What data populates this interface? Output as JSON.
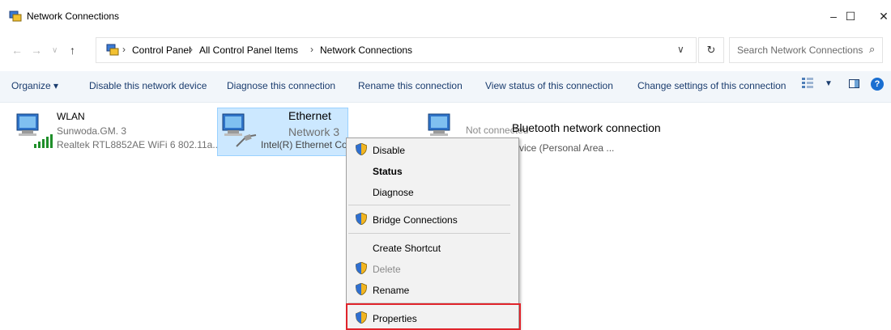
{
  "window": {
    "title": "Network Connections",
    "minimize": "–",
    "maximize": "☐",
    "close": "✕"
  },
  "address": {
    "back": "←",
    "forward": "→",
    "recent": "∨",
    "up": "↑",
    "sep": "›",
    "crumbs": [
      "Control Panel",
      "All Control Panel Items",
      "Network Connections"
    ],
    "dropdown": "∨",
    "refresh": "↻",
    "search_placeholder": "Search Network Connections",
    "search_icon": "⌕"
  },
  "toolbar": {
    "organize": "Organize ▾",
    "disable": "Disable this network device",
    "diagnose": "Diagnose this connection",
    "rename": "Rename this connection",
    "view_status": "View status of this connection",
    "change_settings": "Change settings of this connection",
    "view_dropdown": "▼",
    "help": "?"
  },
  "connections": [
    {
      "name": "WLAN",
      "network": "Sunwoda.GM. 3",
      "adapter": "Realtek RTL8852AE WiFi 6 802.11a..."
    },
    {
      "name": "Ethernet",
      "network": "Network 3",
      "adapter": "Intel(R) Ethernet Co"
    },
    {
      "name": "Bluetooth network connection",
      "network": "Not connected",
      "adapter": "vice (Personal Area ..."
    }
  ],
  "context_menu": {
    "items": [
      "Disable",
      "Status",
      "Diagnose",
      "Bridge Connections",
      "Create Shortcut",
      "Delete",
      "Rename",
      "Properties"
    ]
  },
  "colors": {
    "selection": "#cce8ff",
    "highlight_border": "#e0242b",
    "command_text": "#1a3c6e"
  }
}
